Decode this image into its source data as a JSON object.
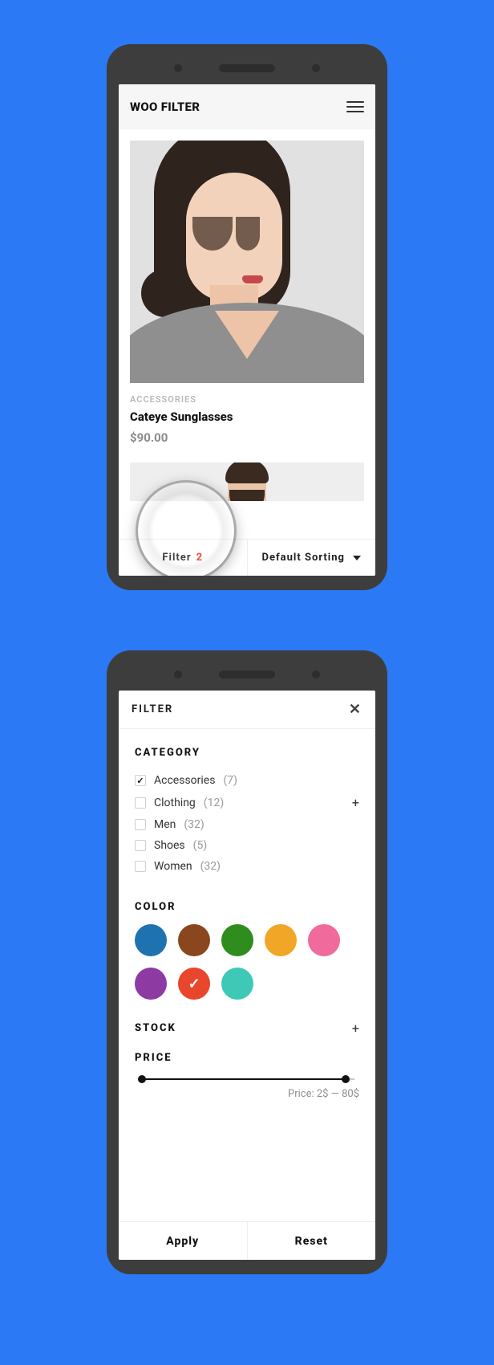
{
  "phone1": {
    "logo": "WOO FILTER",
    "product": {
      "category_label": "ACCESSORIES",
      "name": "Cateye Sunglasses",
      "price": "$90.00"
    },
    "bottom": {
      "filter_label": "Filter",
      "filter_count": "2",
      "sort_label": "Default Sorting"
    }
  },
  "phone2": {
    "header": "FILTER",
    "sections": {
      "category_title": "CATEGORY",
      "color_title": "COLOR",
      "stock_title": "STOCK",
      "price_title": "PRICE"
    },
    "categories": [
      {
        "label": "Accessories",
        "count": "(7)",
        "checked": true,
        "expandable": false
      },
      {
        "label": "Clothing",
        "count": "(12)",
        "checked": false,
        "expandable": true
      },
      {
        "label": "Men",
        "count": "(32)",
        "checked": false,
        "expandable": false
      },
      {
        "label": "Shoes",
        "count": "(5)",
        "checked": false,
        "expandable": false
      },
      {
        "label": "Women",
        "count": "(32)",
        "checked": false,
        "expandable": false
      }
    ],
    "colors": [
      {
        "name": "blue",
        "hex": "#1f72b0",
        "checked": false
      },
      {
        "name": "brown",
        "hex": "#8a461c",
        "checked": false
      },
      {
        "name": "green",
        "hex": "#2f8d1e",
        "checked": false
      },
      {
        "name": "orange",
        "hex": "#f1a627",
        "checked": false
      },
      {
        "name": "pink",
        "hex": "#f06a9b",
        "checked": false
      },
      {
        "name": "purple",
        "hex": "#8d3aa3",
        "checked": false
      },
      {
        "name": "red",
        "hex": "#e8462d",
        "checked": true
      },
      {
        "name": "teal",
        "hex": "#3ec8b6",
        "checked": false
      }
    ],
    "price_readout": "Price: 2$ — 80$",
    "footer": {
      "apply": "Apply",
      "reset": "Reset"
    }
  }
}
